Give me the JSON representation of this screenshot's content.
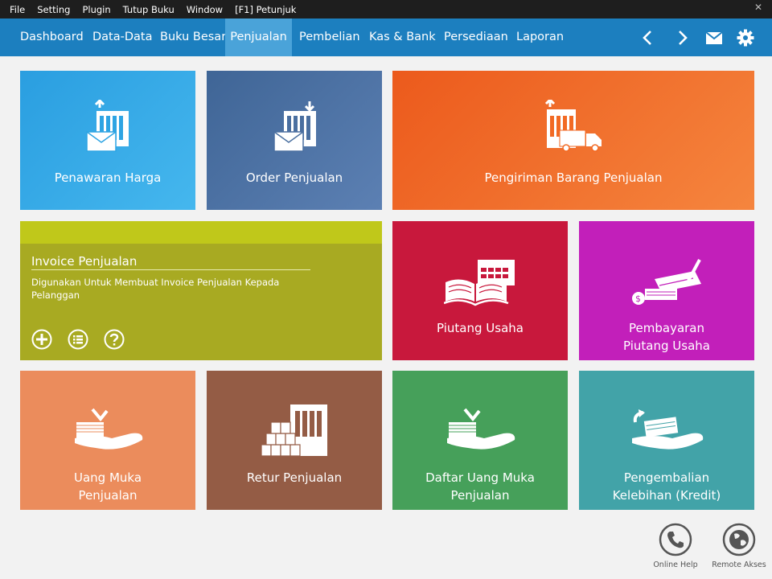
{
  "menu": {
    "items": [
      "File",
      "Setting",
      "Plugin",
      "Tutup Buku",
      "Window",
      "[F1] Petunjuk"
    ],
    "close_glyph": "✕"
  },
  "nav": {
    "tabs": [
      "Dashboard",
      "Data-Data",
      "Buku Besar",
      "Penjualan",
      "Pembelian",
      "Kas & Bank",
      "Persediaan",
      "Laporan"
    ],
    "active_tab": "Penjualan",
    "icons": [
      "chevron-left-icon",
      "chevron-right-icon",
      "mail-icon",
      "gear-icon"
    ],
    "bar_color": "#1c7fbf",
    "active_color": "#4aa3d9"
  },
  "tiles": {
    "penawaran": {
      "label": "Penawaran Harga",
      "icon": "document-envelope-icon",
      "color": "#2ea4e3"
    },
    "order": {
      "label": "Order Penjualan",
      "icon": "document-envelope-icon",
      "color": "#4a6fa0"
    },
    "pengiriman": {
      "label": "Pengiriman Barang Penjualan",
      "icon": "document-truck-icon",
      "color": "#f26a24"
    },
    "invoice": {
      "title": "Invoice Penjualan",
      "description": "Digunakan Untuk Membuat Invoice Penjualan Kepada Pelanggan",
      "actions": [
        "add-icon",
        "list-icon",
        "help-icon"
      ],
      "color": "#a8aa22"
    },
    "piutang": {
      "label": "Piutang Usaha",
      "icon": "ledger-calendar-icon",
      "color": "#c8183c"
    },
    "pembayaran": {
      "line1": "Pembayaran",
      "line2": "Piutang Usaha",
      "icon": "checkbook-icon",
      "color": "#c21fba"
    },
    "uang_muka": {
      "line1": "Uang Muka",
      "line2": "Penjualan",
      "icon": "hand-money-icon",
      "color": "#eb8c5c"
    },
    "retur": {
      "label": "Retur Penjualan",
      "icon": "boxes-document-icon",
      "color": "#945c45"
    },
    "daftar_uang_muka": {
      "line1": "Daftar Uang Muka",
      "line2": "Penjualan",
      "icon": "hand-money-icon",
      "color": "#46a05a"
    },
    "pengembalian": {
      "line1": "Pengembalian",
      "line2": "Kelebihan (Kredit)",
      "icon": "hand-refund-icon",
      "color": "#42a3a8"
    }
  },
  "footer": {
    "online_help": "Online Help",
    "remote_akses": "Remote Akses"
  }
}
